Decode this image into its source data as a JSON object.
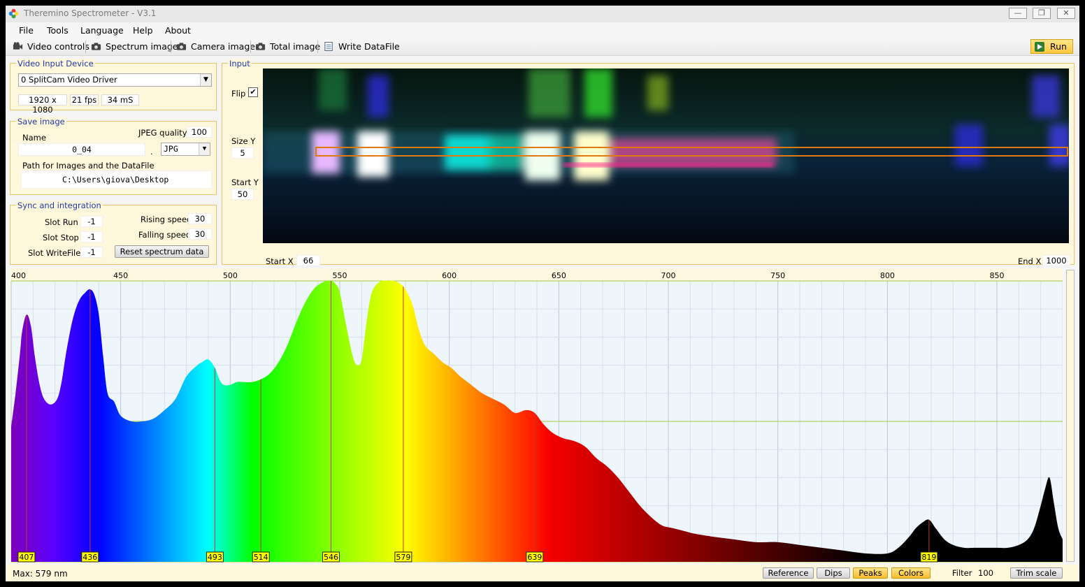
{
  "window": {
    "title": "Theremino Spectrometer - V3.1",
    "controls": [
      "—",
      "❐",
      "✕"
    ]
  },
  "menu": [
    "File",
    "Tools",
    "Language",
    "Help",
    "About"
  ],
  "toolbar": {
    "video_controls": "Video controls",
    "spectrum_image": "Spectrum image",
    "camera_image": "Camera image",
    "total_image": "Total image",
    "write_datafile": "Write DataFile",
    "run": "Run"
  },
  "video_input": {
    "title": "Video Input Device",
    "device": "0 SplitCam Video Driver",
    "resolution": "1920 x 1080",
    "fps": "21 fps",
    "latency": "34 mS"
  },
  "save_image": {
    "title": "Save image",
    "name_label": "Name",
    "name_value": "0_04",
    "dot": ".",
    "format": "JPG",
    "jpeg_quality_label": "JPEG quality",
    "jpeg_quality": "100",
    "path_label": "Path for Images and the DataFile",
    "path": "C:\\Users\\giova\\Desktop"
  },
  "sync": {
    "title": "Sync and integration",
    "slot_run_label": "Slot Run",
    "slot_run": "-1",
    "slot_stop_label": "Slot Stop",
    "slot_stop": "-1",
    "slot_write_label": "Slot WriteFile",
    "slot_write": "-1",
    "rising_label": "Rising speed",
    "rising": "30",
    "falling_label": "Falling speed",
    "falling": "30",
    "reset": "Reset spectrum data"
  },
  "input": {
    "title": "Input",
    "flip_label": "Flip",
    "flip_checked": true,
    "size_y_label": "Size Y",
    "size_y": "5",
    "start_y_label": "Start Y",
    "start_y": "50",
    "start_x_label": "Start X",
    "start_x": "66",
    "end_x_label": "End X",
    "end_x": "1000"
  },
  "chart_data": {
    "type": "area",
    "xlabel": "",
    "ylabel": "",
    "xlim": [
      400,
      880
    ],
    "ylim": [
      0,
      100
    ],
    "x_ticks": [
      400,
      450,
      500,
      550,
      600,
      650,
      700,
      750,
      800,
      850
    ],
    "grid": true,
    "fill": "wavelength-colored",
    "x": [
      400,
      402,
      404,
      405,
      407,
      409,
      411,
      413,
      415,
      418,
      421,
      423,
      425,
      428,
      431,
      434,
      436,
      438,
      440,
      442,
      444,
      447,
      450,
      455,
      460,
      465,
      470,
      475,
      480,
      485,
      487,
      490,
      493,
      495,
      497,
      500,
      503,
      506,
      510,
      514,
      518,
      522,
      526,
      530,
      534,
      538,
      541,
      544,
      546,
      548,
      550,
      553,
      556,
      558,
      560,
      562,
      564,
      566,
      569,
      572,
      575,
      579,
      583,
      586,
      589,
      593,
      597,
      601,
      605,
      610,
      615,
      620,
      625,
      630,
      635,
      639,
      643,
      647,
      652,
      657,
      662,
      667,
      672,
      677,
      682,
      687,
      692,
      697,
      702,
      707,
      712,
      720,
      730,
      740,
      750,
      760,
      770,
      780,
      790,
      800,
      805,
      810,
      813,
      816,
      819,
      822,
      826,
      830,
      835,
      840,
      845,
      850,
      855,
      860,
      864,
      867,
      870,
      872,
      874,
      876,
      878,
      880
    ],
    "y": [
      48,
      60,
      74,
      82,
      88,
      84,
      72,
      63,
      58,
      56,
      58,
      64,
      74,
      86,
      93,
      96,
      97,
      95,
      88,
      73,
      60,
      57,
      52,
      50,
      50,
      51,
      54,
      58,
      66,
      70,
      71,
      72,
      69,
      65,
      63,
      63,
      64,
      64,
      64,
      65,
      67,
      71,
      77,
      85,
      92,
      97,
      99,
      100,
      100,
      99,
      96,
      84,
      73,
      70,
      72,
      84,
      94,
      98,
      100,
      100,
      100,
      98,
      92,
      83,
      77,
      74,
      71,
      69,
      66,
      63,
      60,
      58,
      56,
      53,
      54,
      53,
      49,
      46,
      44,
      43,
      41,
      37,
      34,
      30,
      25,
      20,
      16,
      13,
      12,
      11,
      10,
      9,
      8,
      7,
      7,
      6,
      5,
      4,
      3,
      3,
      5,
      9,
      12,
      14,
      15,
      12,
      8,
      6,
      5,
      5,
      5,
      5,
      5,
      6,
      8,
      12,
      20,
      26,
      30,
      21,
      12,
      8
    ],
    "peaks": [
      407,
      436,
      493,
      514,
      546,
      579,
      639,
      819
    ],
    "max_label": "Max: 579 nm"
  },
  "statusbar": {
    "max": "Max: 579 nm",
    "reference": "Reference",
    "dips": "Dips",
    "peaks": "Peaks",
    "colors": "Colors",
    "filter_label": "Filter",
    "filter": "100",
    "trim": "Trim scale"
  },
  "colors": {
    "panel_bg": "#fff7dc",
    "panel_border": "#e5c56a",
    "group_title": "#1f3aa8",
    "active_button": "#ffd34f",
    "peak_label_bg": "#ffff00",
    "peak_line": "#c0392b"
  }
}
